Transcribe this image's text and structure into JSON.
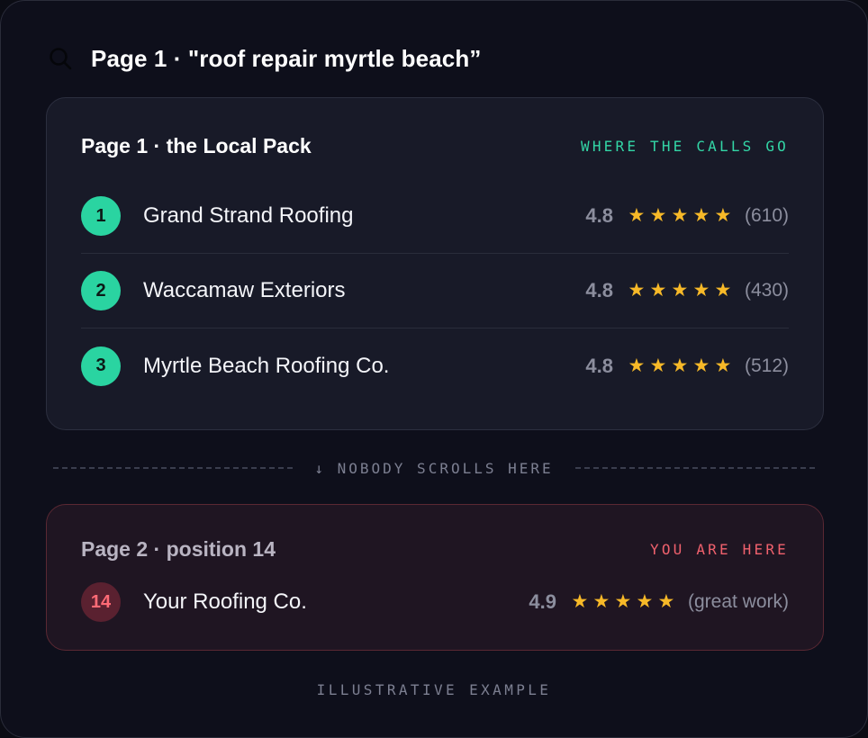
{
  "search": {
    "title": "Page 1 · \"roof repair myrtle beach”",
    "icon": "search-icon"
  },
  "local_pack": {
    "title": "Page 1 · the Local Pack",
    "tag": "WHERE THE CALLS GO",
    "tag_color": "#33d6a6",
    "results": [
      {
        "rank": "1",
        "name": "Grand Strand Roofing",
        "score": "4.8",
        "stars": 5,
        "count": "(610)"
      },
      {
        "rank": "2",
        "name": "Waccamaw Exteriors",
        "score": "4.8",
        "stars": 5,
        "count": "(430)"
      },
      {
        "rank": "3",
        "name": "Myrtle Beach Roofing Co.",
        "score": "4.8",
        "stars": 5,
        "count": "(512)"
      }
    ]
  },
  "divider": {
    "label": "↓ NOBODY SCROLLS HERE"
  },
  "you": {
    "title": "Page 2 · position 14",
    "tag": "YOU ARE HERE",
    "tag_color": "#f0616d",
    "rank": "14",
    "name": "Your Roofing Co.",
    "score": "4.9",
    "stars": 5,
    "note": "(great work)"
  },
  "footer": {
    "label": "ILLUSTRATIVE EXAMPLE"
  },
  "colors": {
    "star": "#f7b928",
    "badge_green": "#2ad4a1",
    "badge_red": "#5a2130"
  }
}
